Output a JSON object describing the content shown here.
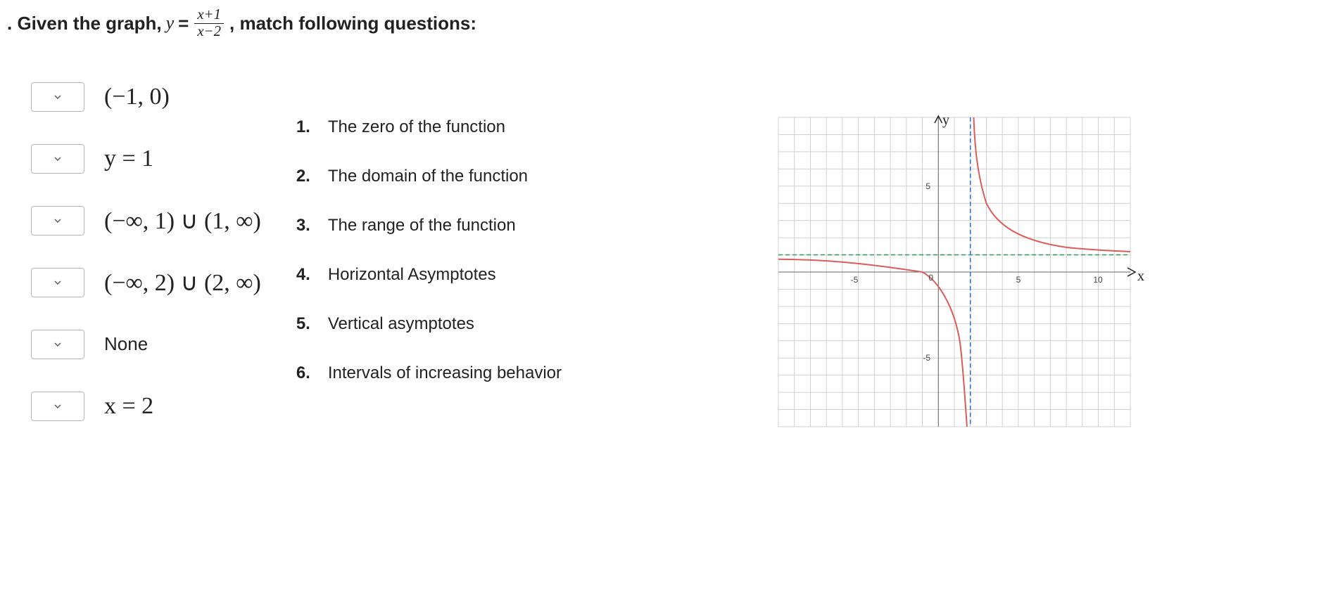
{
  "header": {
    "prefix": ". Given the graph, ",
    "equals": " = ",
    "numerator": "x+1",
    "denominator": "x−2",
    "suffix": ", match following questions:"
  },
  "answers": [
    {
      "text": "(−1, 0)",
      "variant": "math"
    },
    {
      "text": "y = 1",
      "variant": "math"
    },
    {
      "text": "(−∞, 1) ∪ (1, ∞)",
      "variant": "math"
    },
    {
      "text": "(−∞, 2) ∪ (2, ∞)",
      "variant": "math"
    },
    {
      "text": "None",
      "variant": "none"
    },
    {
      "text": "x = 2",
      "variant": "math"
    }
  ],
  "questions": [
    {
      "num": "1.",
      "text": "The zero of the function"
    },
    {
      "num": "2.",
      "text": "The domain of the function"
    },
    {
      "num": "3.",
      "text": "The range of the function"
    },
    {
      "num": "4.",
      "text": "Horizontal Asymptotes"
    },
    {
      "num": "5.",
      "text": "Vertical asymptotes"
    },
    {
      "num": "6.",
      "text": "Intervals of increasing behavior"
    }
  ],
  "chart_data": {
    "type": "line",
    "title": "",
    "function": "y = (x+1)/(x-2)",
    "xlabel": "x",
    "ylabel": "y",
    "xlim": [
      -10,
      12
    ],
    "ylim": [
      -9,
      9
    ],
    "ticks": {
      "x": [
        -5,
        5,
        10
      ],
      "y": [
        -5,
        5
      ]
    },
    "origin_label": "0",
    "asymptotes": {
      "horizontal": 1,
      "vertical": 2
    },
    "series": [
      {
        "name": "left-branch",
        "x_range": [
          -10,
          1.9
        ],
        "values_sample": [
          [
            -10,
            0.75
          ],
          [
            -5,
            0.571
          ],
          [
            -1,
            0
          ],
          [
            0,
            -0.5
          ],
          [
            1,
            -2
          ],
          [
            1.5,
            -5
          ],
          [
            1.8,
            -14
          ]
        ]
      },
      {
        "name": "right-branch",
        "x_range": [
          2.1,
          12
        ],
        "values_sample": [
          [
            2.2,
            16
          ],
          [
            2.5,
            7
          ],
          [
            3,
            4
          ],
          [
            4,
            2.5
          ],
          [
            6,
            1.75
          ],
          [
            10,
            1.375
          ],
          [
            12,
            1.3
          ]
        ]
      }
    ]
  }
}
